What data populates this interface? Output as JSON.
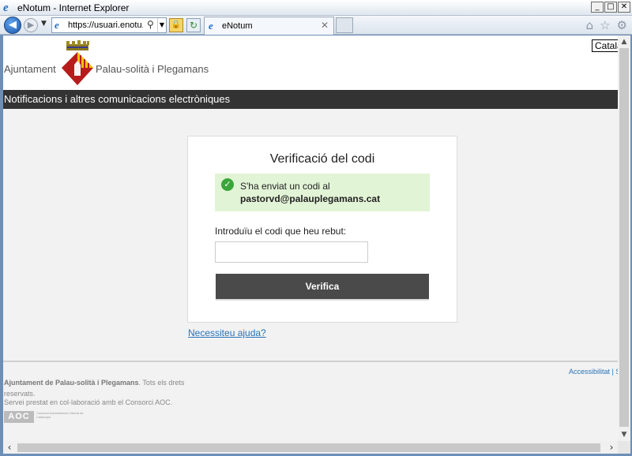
{
  "window": {
    "title": "eNotum - Internet Explorer",
    "minimize": "_",
    "maximize": "□",
    "close": "✕"
  },
  "browser": {
    "address": "https://usuari.enotu...",
    "search_glyph": "⚲",
    "tab_label": "eNotum",
    "tab_close": "✕",
    "home_glyph": "⌂",
    "star_glyph": "☆",
    "gear_glyph": "⚙"
  },
  "header": {
    "language": "Català",
    "brand_left": "Ajuntament",
    "brand_right": "Palau-solità i Plegamans",
    "subheader": "Notificacions i altres comunicacions electròniques"
  },
  "card": {
    "title": "Verificació del codi",
    "alert_line1": "S'ha enviat un codi al",
    "alert_email": "pastorvd@palauplegamans.cat",
    "code_label": "Introduïu el codi que heu rebut:",
    "code_value": "",
    "verify_label": "Verifica"
  },
  "help_link": "Necessiteu ajuda?",
  "footer": {
    "accessibility": "Accessibilitat | S",
    "org_bold": "Ajuntament de Palau-solità i Plegamans",
    "org_rest": ". Tots els drets reservats.",
    "service": "Servei prestat en col·laboració amb el Consorci AOC.",
    "aoc_logo": "AOC",
    "aoc_text": "Consorci Administració Oberta de Catalunya"
  },
  "colors": {
    "subheader_bg": "#333333",
    "alert_bg": "#e2f4d6",
    "success_icon": "#3aa63a",
    "button_bg": "#4a4a4a",
    "link": "#2a73b8"
  },
  "icons": [
    "ie-icon",
    "back-arrow-icon",
    "forward-arrow-icon",
    "search-icon",
    "lock-icon",
    "refresh-icon",
    "close-icon",
    "home-icon",
    "favorites-star-icon",
    "settings-gear-icon",
    "check-circle-icon",
    "crest-icon"
  ]
}
